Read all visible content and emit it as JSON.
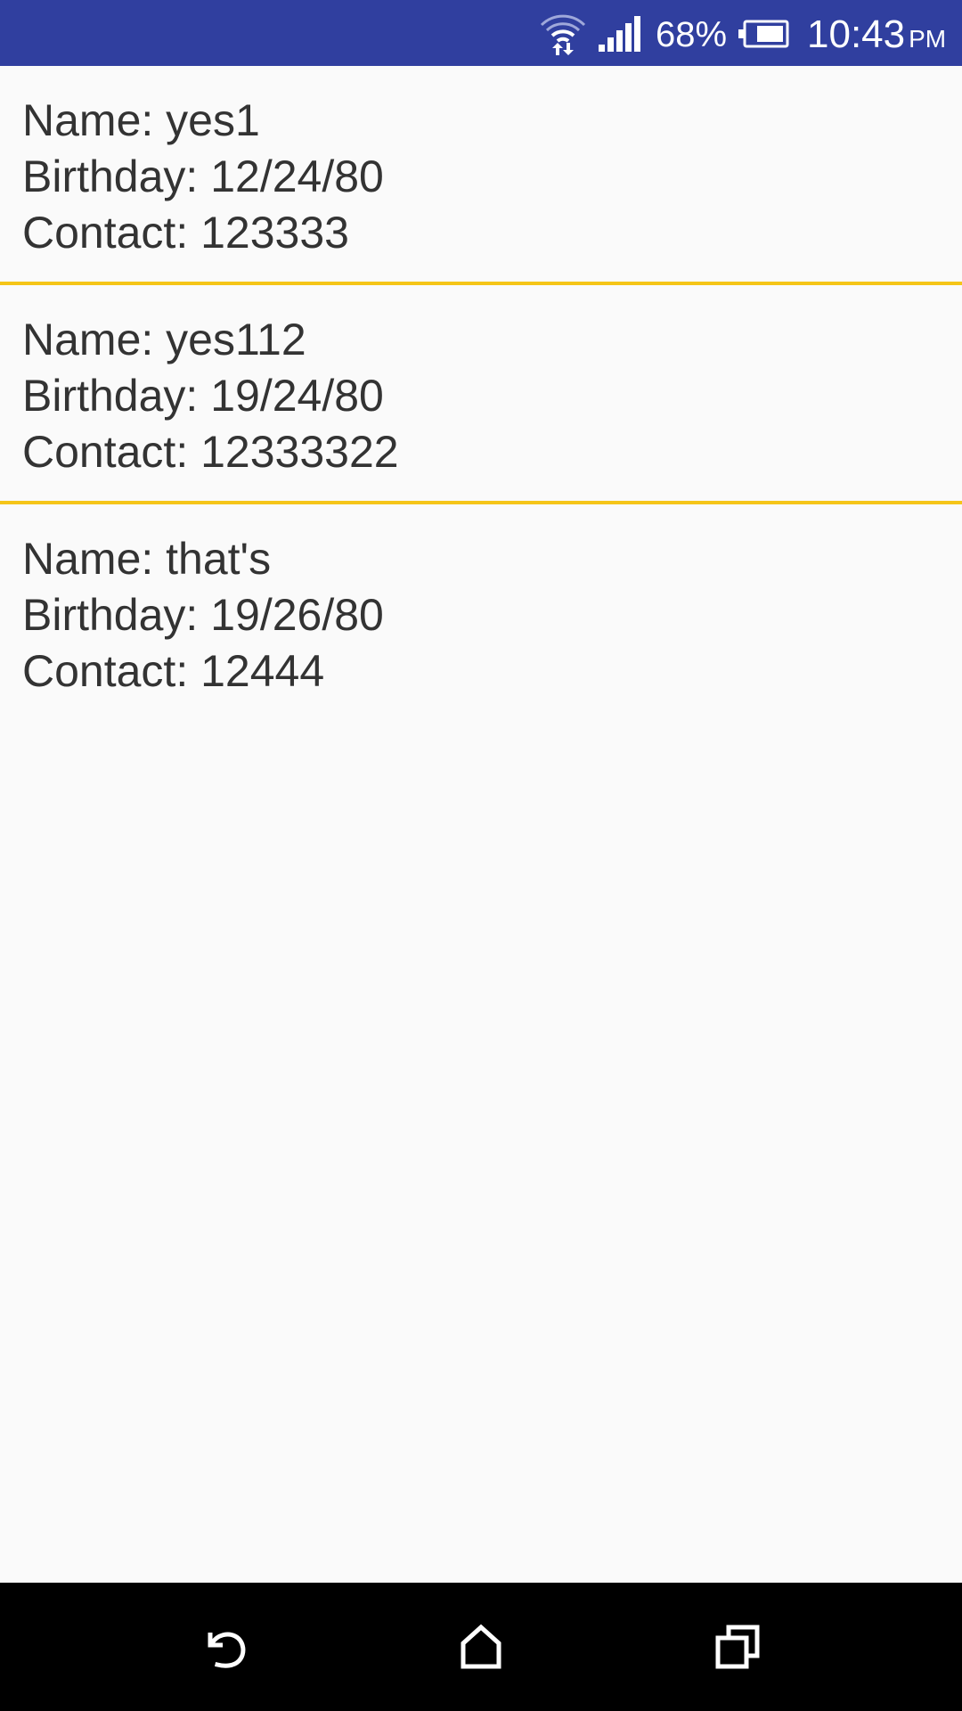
{
  "status_bar": {
    "icons": [
      "wifi-data-icon",
      "cell-signal-icon",
      "battery-icon"
    ],
    "battery_percent": "68%",
    "time": "10:43",
    "ampm": "PM",
    "background_color": "#303f9f"
  },
  "list": {
    "divider_color": "#f5c518",
    "items": [
      {
        "name": "Name: yes1",
        "birthday": "Birthday: 12/24/80",
        "contact": "Contact: 123333"
      },
      {
        "name": "Name: yes112",
        "birthday": "Birthday: 19/24/80",
        "contact": "Contact: 12333322"
      },
      {
        "name": "Name: that's",
        "birthday": "Birthday: 19/26/80",
        "contact": "Contact: 12444"
      }
    ]
  },
  "nav_bar": {
    "icons": [
      "back-icon",
      "home-icon",
      "recents-icon"
    ]
  }
}
